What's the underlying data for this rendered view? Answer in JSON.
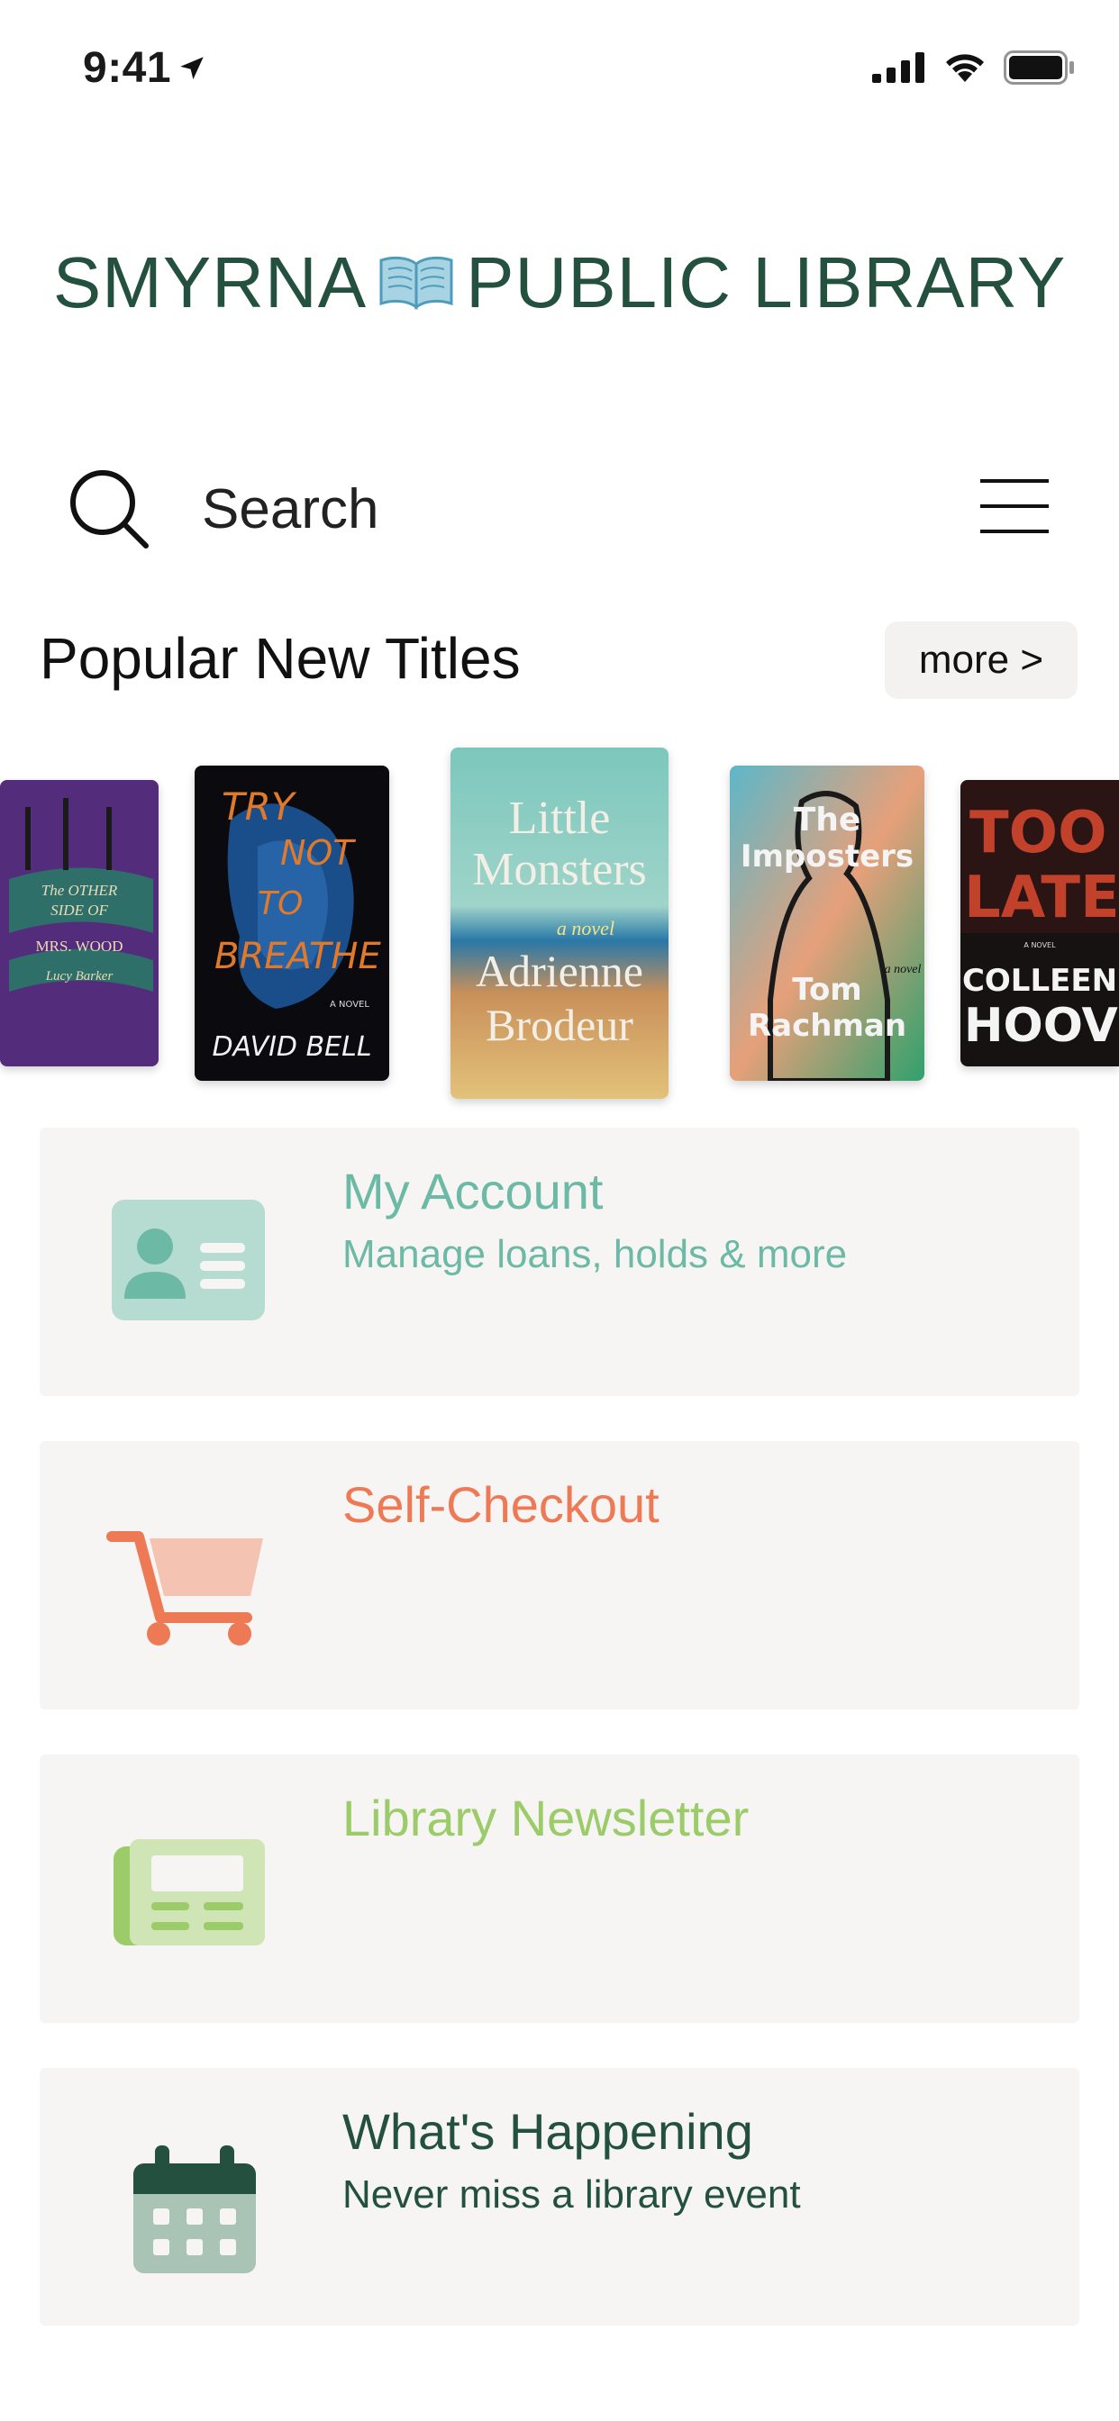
{
  "status_bar": {
    "time": "9:41",
    "icons": [
      "location-arrow-icon",
      "signal-icon",
      "wifi-icon",
      "battery-icon"
    ]
  },
  "header": {
    "logo_left": "SMYRNA",
    "logo_right": "PUBLIC LIBRARY",
    "logo_icon": "open-book-icon",
    "brand_color": "#24513f"
  },
  "search": {
    "label": "Search",
    "icon": "search-icon",
    "menu_icon": "hamburger-menu-icon"
  },
  "popular": {
    "title": "Popular New Titles",
    "more_label": "more >",
    "books": [
      {
        "title_lines": [
          "The OTHER",
          "SIDE OF",
          "MRS. WOOD"
        ],
        "author": "Lucy Barker"
      },
      {
        "title_lines": [
          "TRY",
          "NOT",
          "TO",
          "BREATHE"
        ],
        "tagline": "A NOVEL",
        "author": "DAVID BELL"
      },
      {
        "title_lines": [
          "Little",
          "Monsters"
        ],
        "tagline": "a novel",
        "author_lines": [
          "Adrienne",
          "Brodeur"
        ]
      },
      {
        "title_lines": [
          "The",
          "Imposters"
        ],
        "tagline": "a novel",
        "author_lines": [
          "Tom",
          "Rachman"
        ]
      },
      {
        "title_lines": [
          "TOO",
          "LATE"
        ],
        "tagline": "A NOVEL",
        "author_lines": [
          "COLLEEN",
          "HOOVER"
        ]
      }
    ]
  },
  "cards": [
    {
      "title": "My Account",
      "subtitle": "Manage loans, holds & more",
      "icon": "id-card-icon",
      "color": "#6cb9a5"
    },
    {
      "title": "Self-Checkout",
      "subtitle": "",
      "icon": "shopping-cart-icon",
      "color": "#ee7a55"
    },
    {
      "title": "Library Newsletter",
      "subtitle": "",
      "icon": "newspaper-icon",
      "color": "#9ccb6a"
    },
    {
      "title": "What's Happening",
      "subtitle": "Never miss a library event",
      "icon": "calendar-icon",
      "color": "#24513f"
    }
  ]
}
